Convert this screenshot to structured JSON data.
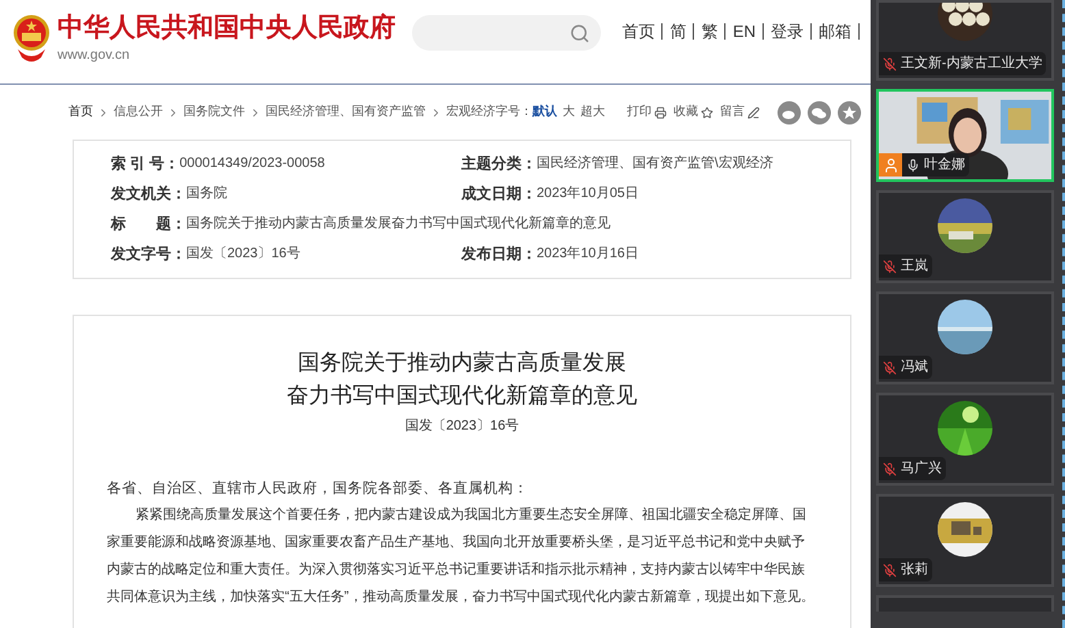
{
  "header": {
    "site_title": "中华人民共和国中央人民政府",
    "site_url": "www.gov.cn",
    "nav": [
      "首页",
      "简",
      "繁",
      "EN",
      "登录",
      "邮箱"
    ]
  },
  "breadcrumb": [
    "首页",
    "信息公开",
    "国务院文件",
    "国民经济管理、国有资产监管",
    "宏观经济"
  ],
  "font_size": {
    "label": "字号：",
    "options": [
      {
        "label": "默认",
        "selected": true
      },
      {
        "label": "大",
        "selected": false
      },
      {
        "label": "超大",
        "selected": false
      }
    ]
  },
  "actions": [
    "打印",
    "收藏",
    "留言"
  ],
  "meta": [
    {
      "label": "索 引 号：",
      "value": "000014349/2023-00058",
      "label2": "主题分类：",
      "value2": "国民经济管理、国有资产监管\\宏观经济"
    },
    {
      "label": "发文机关：",
      "value": "国务院",
      "label2": "成文日期：",
      "value2": "2023年10月05日"
    },
    {
      "label": "标　　题：",
      "value": "国务院关于推动内蒙古高质量发展奋力书写中国式现代化新篇章的意见"
    },
    {
      "label": "发文字号：",
      "value": "国发〔2023〕16号",
      "label2": "发布日期：",
      "value2": "2023年10月16日"
    }
  ],
  "article": {
    "title_lines": [
      "国务院关于推动内蒙古高质量发展",
      "奋力书写中国式现代化新篇章的意见"
    ],
    "doc_number": "国发〔2023〕16号",
    "salutation": "各省、自治区、直辖市人民政府，国务院各部委、各直属机构：",
    "paragraphs": [
      "紧紧围绕高质量发展这个首要任务，把内蒙古建设成为我国北方重要生态安全屏障、祖国北疆安全稳定屏障、国家重要能源和战略资源基地、国家重要农畜产品生产基地、我国向北开放重要桥头堡，是习近平总书记和党中央赋予内蒙古的战略定位和重大责任。为深入贯彻落实习近平总书记重要讲话和指示批示精神，支持内蒙古以铸牢中华民族共同体意识为主线，加快落实“五大任务”，推动高质量发展，奋力书写中国式现代化内蒙古新篇章，现提出如下意见。"
    ]
  },
  "participants": [
    {
      "kind": "avatar",
      "name": "王文新-内蒙古工业大学",
      "muted": true,
      "selected": false
    },
    {
      "kind": "video",
      "name": "叶金娜",
      "muted": false,
      "selected": true
    },
    {
      "kind": "avatar",
      "name": "王岚",
      "muted": true,
      "selected": false
    },
    {
      "kind": "avatar",
      "name": "冯斌",
      "muted": true,
      "selected": false
    },
    {
      "kind": "avatar",
      "name": "马广兴",
      "muted": true,
      "selected": false
    },
    {
      "kind": "avatar",
      "name": "张莉",
      "muted": true,
      "selected": false
    }
  ]
}
